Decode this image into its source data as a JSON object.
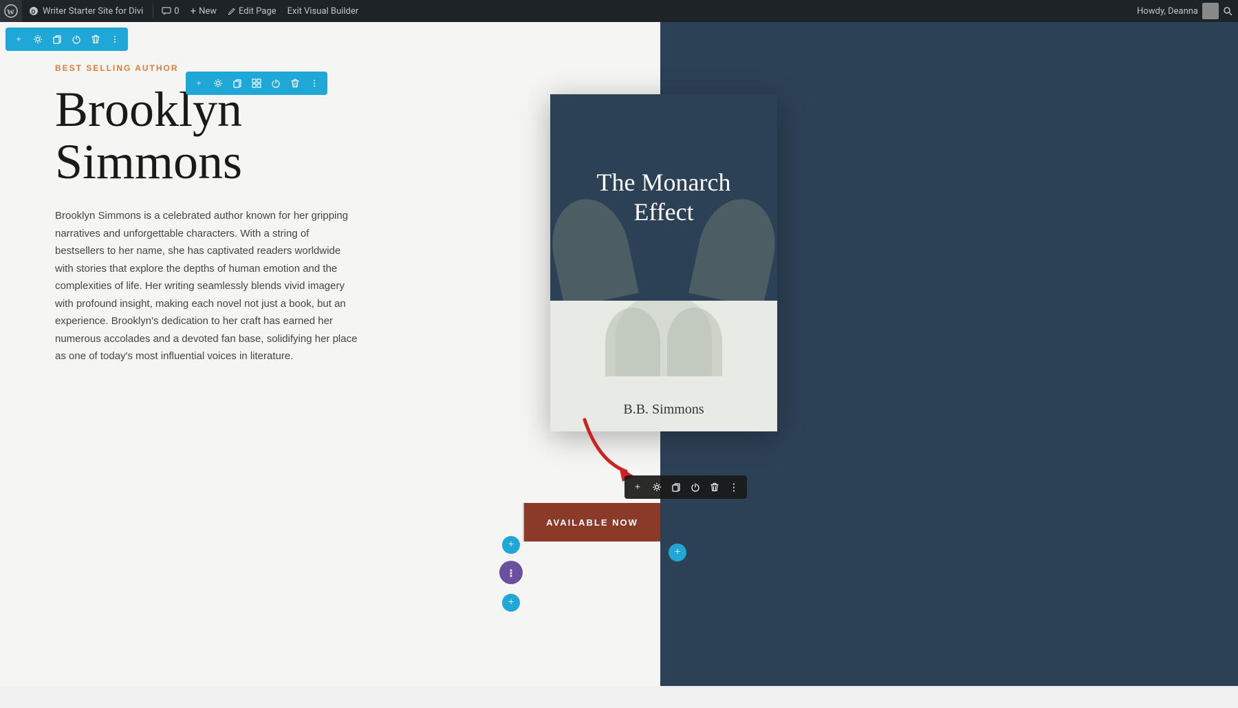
{
  "adminBar": {
    "siteName": "Writer Starter Site for Divi",
    "comments": "0",
    "newLabel": "New",
    "editPageLabel": "Edit Page",
    "exitLabel": "Exit Visual Builder",
    "howdy": "Howdy, Deanna"
  },
  "page": {
    "bestSellingLabel": "BEST SELLING AUTHOR",
    "authorName": "Brooklyn\nSimmons",
    "authorBio": "Brooklyn Simmons is a celebrated author known for her gripping narratives and unforgettable characters. With a string of bestsellers to her name, she has captivated readers worldwide with stories that explore the depths of human emotion and the complexities of life. Her writing seamlessly blends vivid imagery with profound insight, making each novel not just a book, but an experience. Brooklyn's dedication to her craft has earned her numerous accolades and a devoted fan base, solidifying her place as one of today's most influential voices in literature."
  },
  "bookCover": {
    "title": "The Monarch Effect",
    "authorName": "B.B. Simmons"
  },
  "cta": {
    "buttonLabel": "AVAILABLE NOW"
  },
  "toolbar": {
    "addIcon": "+",
    "settingsIcon": "⚙",
    "duplicateIcon": "❐",
    "gridIcon": "⊞",
    "powerIcon": "⏻",
    "trashIcon": "🗑",
    "moreIcon": "⋮"
  }
}
